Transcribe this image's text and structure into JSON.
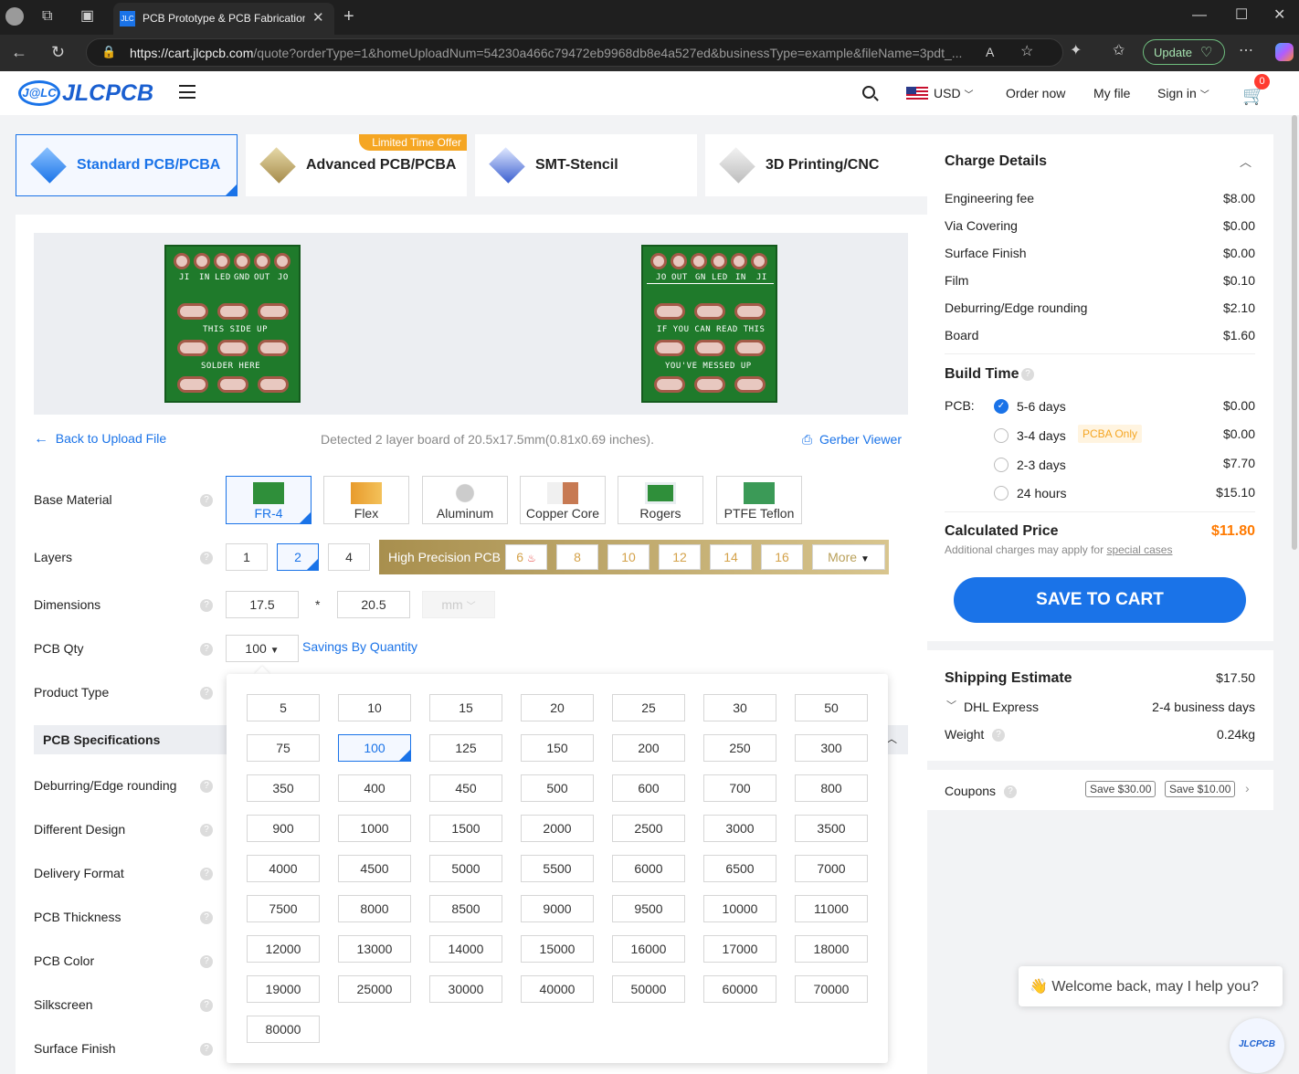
{
  "browser": {
    "tab_title": "PCB Prototype & PCB Fabrication",
    "tab_favicon": "JLC",
    "url_host": "https://cart.jlcpcb.com",
    "url_path": "/quote?orderType=1&homeUploadNum=54230a466c79472eb9968db8e4a527ed&businessType=example&fileName=3pdt_...",
    "update_label": "Update"
  },
  "header": {
    "logo_text": "JLCPCB",
    "logo_badge": "J@LC",
    "currency": "USD",
    "order_now": "Order now",
    "my_file": "My file",
    "sign_in": "Sign in",
    "cart_count": "0"
  },
  "product_tabs": [
    {
      "label": "Standard PCB/PCBA"
    },
    {
      "label": "Advanced PCB/PCBA",
      "badge": "Limited Time Offer"
    },
    {
      "label": "SMT-Stencil"
    },
    {
      "label": "3D Printing/CNC"
    }
  ],
  "preview": {
    "top_labels": [
      "JI",
      "IN",
      "LED",
      "GND",
      "OUT",
      "JO"
    ],
    "top_text1": "THIS SIDE UP",
    "top_text2": "SOLDER HERE",
    "bottom_labels": [
      "JO",
      "OUT",
      "GN",
      "LED",
      "IN",
      "JI"
    ],
    "bottom_text1": "IF YOU CAN READ THIS",
    "bottom_text2": "YOU'VE MESSED UP"
  },
  "upload": {
    "back": "Back to Upload File",
    "detected": "Detected 2 layer board of 20.5x17.5mm(0.81x0.69 inches).",
    "gerber": "Gerber Viewer"
  },
  "form": {
    "base_material": {
      "label": "Base Material",
      "options": [
        "FR-4",
        "Flex",
        "Aluminum",
        "Copper Core",
        "Rogers",
        "PTFE Teflon"
      ],
      "selected": "FR-4"
    },
    "layers": {
      "label": "Layers",
      "options": [
        "1",
        "2",
        "4"
      ],
      "selected": "2",
      "hp_label": "High Precision PCB",
      "hp_options": [
        "6",
        "8",
        "10",
        "12",
        "14",
        "16"
      ],
      "more": "More"
    },
    "dimensions": {
      "label": "Dimensions",
      "w": "17.5",
      "h": "20.5",
      "sep": "*",
      "unit": "mm"
    },
    "qty": {
      "label": "PCB Qty",
      "value": "100",
      "savings": "Savings By Quantity"
    },
    "product_type": {
      "label": "Product Type"
    },
    "spec_header": "PCB Specifications",
    "other_labels": [
      "Deburring/Edge rounding",
      "Different Design",
      "Delivery Format",
      "PCB Thickness",
      "PCB Color",
      "Silkscreen",
      "Surface Finish"
    ],
    "help": "?"
  },
  "qty_options": [
    "5",
    "10",
    "15",
    "20",
    "25",
    "30",
    "50",
    "75",
    "100",
    "125",
    "150",
    "200",
    "250",
    "300",
    "350",
    "400",
    "450",
    "500",
    "600",
    "700",
    "800",
    "900",
    "1000",
    "1500",
    "2000",
    "2500",
    "3000",
    "3500",
    "4000",
    "4500",
    "5000",
    "5500",
    "6000",
    "6500",
    "7000",
    "7500",
    "8000",
    "8500",
    "9000",
    "9500",
    "10000",
    "11000",
    "12000",
    "13000",
    "14000",
    "15000",
    "16000",
    "17000",
    "18000",
    "19000",
    "25000",
    "30000",
    "40000",
    "50000",
    "60000",
    "70000",
    "80000"
  ],
  "qty_selected": "100",
  "charge": {
    "title": "Charge Details",
    "items": [
      {
        "name": "Engineering fee",
        "value": "$8.00"
      },
      {
        "name": "Via Covering",
        "value": "$0.00"
      },
      {
        "name": "Surface Finish",
        "value": "$0.00"
      },
      {
        "name": "Film",
        "value": "$0.10"
      },
      {
        "name": "Deburring/Edge rounding",
        "value": "$2.10"
      },
      {
        "name": "Board",
        "value": "$1.60"
      }
    ],
    "build_title": "Build Time",
    "pcb_label": "PCB:",
    "build_options": [
      {
        "label": "5-6 days",
        "value": "$0.00",
        "checked": true
      },
      {
        "label": "3-4 days",
        "value": "$0.00",
        "tag": "PCBA Only"
      },
      {
        "label": "2-3 days",
        "value": "$7.70"
      },
      {
        "label": "24 hours",
        "value": "$15.10"
      }
    ],
    "calc_label": "Calculated Price",
    "calc_value": "$11.80",
    "note_prefix": "Additional charges may apply for ",
    "note_link": "special cases",
    "save_btn": "SAVE TO CART"
  },
  "shipping": {
    "title": "Shipping Estimate",
    "price": "$17.50",
    "carrier": "DHL Express",
    "days": "2-4 business days",
    "weight_label": "Weight",
    "weight": "0.24kg"
  },
  "coupons": {
    "label": "Coupons",
    "c1": "Save $30.00",
    "c2": "Save $10.00"
  },
  "chat": {
    "text": "👋 Welcome back, may I help you?",
    "bubble": "JLCPCB"
  },
  "colors": {
    "accent": "#1a73e8",
    "price": "#ff7a00",
    "hp_gold": "#b9a05a"
  }
}
